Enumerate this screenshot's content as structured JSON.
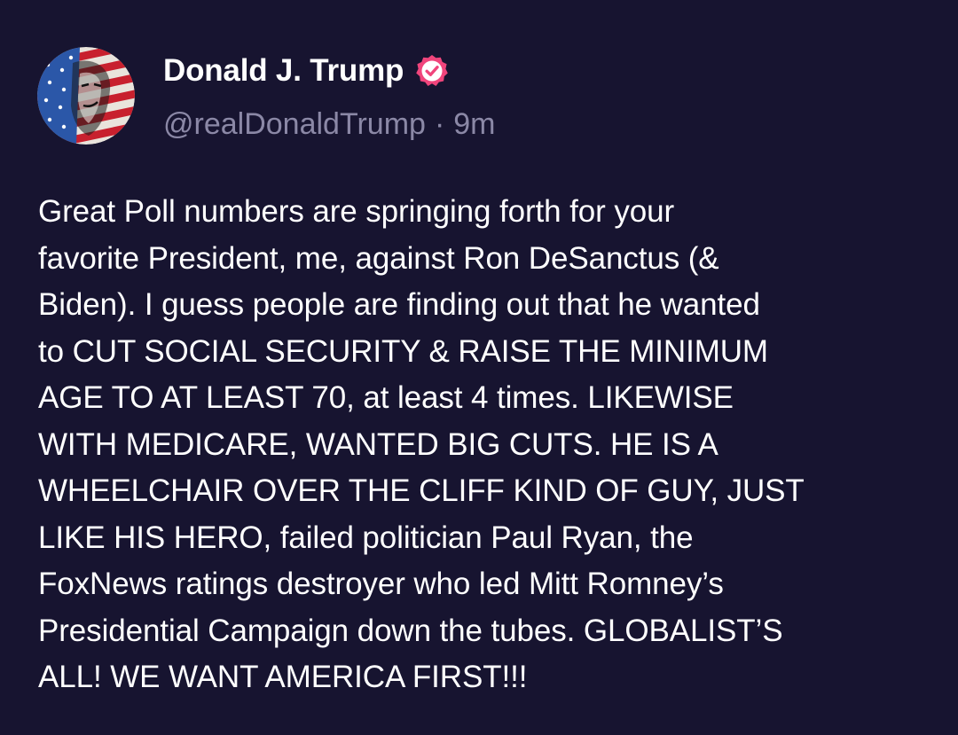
{
  "author": {
    "display_name": "Donald J. Trump",
    "handle": "@realDonaldTrump",
    "separator": "·",
    "timestamp": "9m",
    "verified": true,
    "avatar_icon": "flag-portrait-avatar",
    "verified_icon": "verified-badge-icon",
    "verified_color": "#f0457c"
  },
  "post": {
    "text": "Great Poll numbers are springing forth for your\nfavorite President, me, against Ron DeSanctus (&\nBiden). I guess people are finding out that he wanted\nto CUT SOCIAL SECURITY & RAISE THE MINIMUM\nAGE TO AT LEAST 70, at least 4 times. LIKEWISE\nWITH MEDICARE, WANTED BIG CUTS. HE IS A\nWHEELCHAIR OVER THE CLIFF KIND OF GUY, JUST\nLIKE HIS HERO, failed politician Paul Ryan, the\nFoxNews ratings destroyer who led Mitt Romney’s\nPresidential Campaign down the tubes. GLOBALIST’S\nALL! WE WANT AMERICA FIRST!!!"
  },
  "theme": {
    "background": "#171430",
    "text_primary": "#ffffff",
    "text_secondary": "#8b88a6"
  }
}
